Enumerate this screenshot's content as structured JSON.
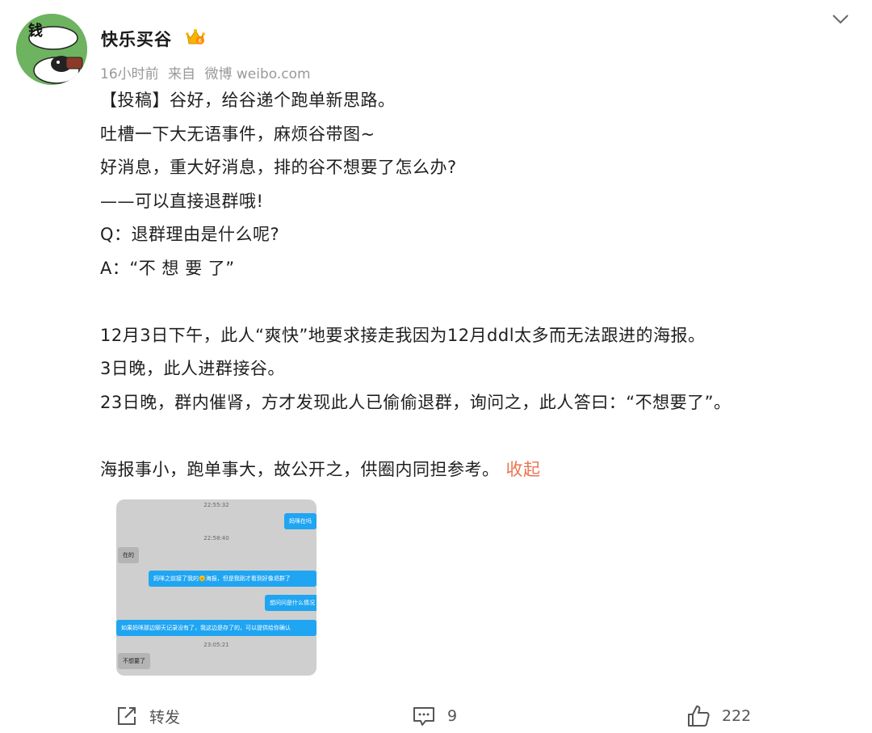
{
  "post": {
    "author": "快乐买谷",
    "avatar_text": "钱",
    "meta": {
      "time": "16小时前",
      "source_prefix": "来自",
      "source": "微博 weibo.com"
    },
    "content_lines": [
      "【投稿】谷好，给谷递个跑单新思路。",
      "吐槽一下大无语事件，麻烦谷带图~",
      "好消息，重大好消息，排的谷不想要了怎么办?",
      "——可以直接退群哦!",
      "Q：退群理由是什么呢?",
      "A：“不 想 要 了”",
      "",
      "12月3日下午，此人“爽快”地要求接走我因为12月ddl太多而无法跟进的海报。",
      "3日晚，此人进群接谷。",
      "23日晚，群内催肾，方才发现此人已偷偷退群，询问之，此人答曰：“不想要了”。",
      "",
      "海报事小，跑单事大，故公开之，供圈内同担参考。"
    ],
    "collapse_label": "收起",
    "image": {
      "messages": [
        {
          "type": "time",
          "text": "22:55:32"
        },
        {
          "type": "me",
          "text": "妈咪在吗"
        },
        {
          "type": "time",
          "text": "22:58:40"
        },
        {
          "type": "them",
          "text": "在的"
        },
        {
          "type": "me",
          "text": "妈咪之前接了我的🌞海报，但是我刚才看到好像退群了"
        },
        {
          "type": "me",
          "text": "想问问是什么情况"
        },
        {
          "type": "me",
          "text": "如果妈咪那边聊天记录没有了，我这边是存了的，可以提供给你确认"
        },
        {
          "type": "time",
          "text": "23:05:21"
        },
        {
          "type": "them",
          "text": "不想要了"
        }
      ]
    },
    "actions": {
      "repost_label": "转发",
      "comment_count": "9",
      "like_count": "222"
    },
    "colors": {
      "link": "#eb7350",
      "meta": "#999999",
      "bubble_me": "#1fa5f2"
    }
  }
}
